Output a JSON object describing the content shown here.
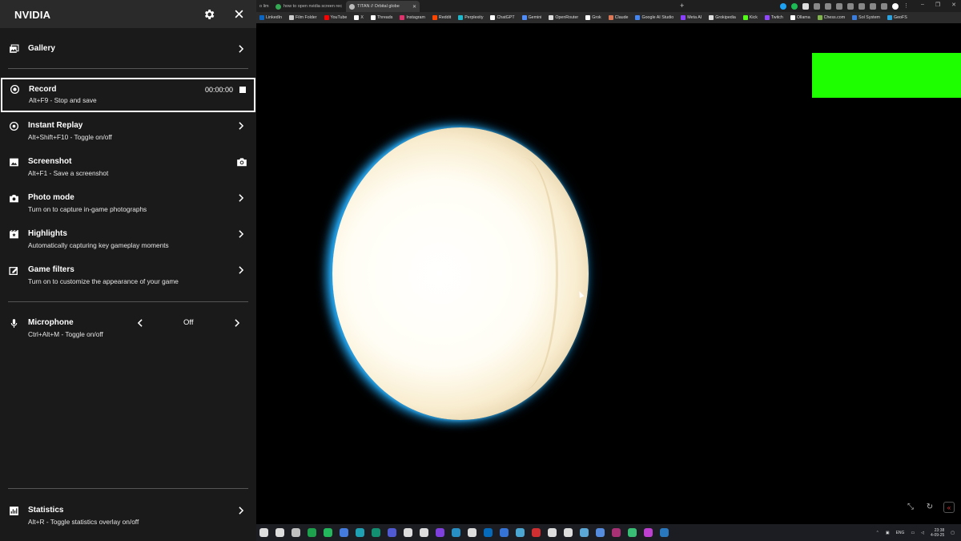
{
  "overlay": {
    "title": "NVIDIA",
    "gallery": {
      "label": "Gallery"
    },
    "record": {
      "label": "Record",
      "sub": "Alt+F9 - Stop and save",
      "time": "00:00:00"
    },
    "instant_replay": {
      "label": "Instant Replay",
      "sub": "Alt+Shift+F10 - Toggle on/off"
    },
    "screenshot": {
      "label": "Screenshot",
      "sub": "Alt+F1 - Save a screenshot"
    },
    "photo_mode": {
      "label": "Photo mode",
      "sub": "Turn on to capture in-game photographs"
    },
    "highlights": {
      "label": "Highlights",
      "sub": "Automatically capturing key gameplay moments"
    },
    "game_filters": {
      "label": "Game filters",
      "sub": "Turn on to customize the appearance of your game"
    },
    "microphone": {
      "label": "Microphone",
      "sub": "Ctrl+Alt+M - Toggle on/off",
      "value": "Off"
    },
    "statistics": {
      "label": "Statistics",
      "sub": "Alt+R - Toggle statistics overlay on/off"
    }
  },
  "browser": {
    "tabs": [
      {
        "title": "o lim",
        "state": "inactive"
      },
      {
        "title": "how to open nvidia screen rec",
        "state": "inactive"
      },
      {
        "title": "TITAN // Orbital globe",
        "state": "active"
      }
    ],
    "bookmarks": [
      {
        "label": "LinkedIn",
        "color": "#0a66c2"
      },
      {
        "label": "Film Folder",
        "color": "#cccccc"
      },
      {
        "label": "YouTube",
        "color": "#ff0000"
      },
      {
        "label": "X",
        "color": "#ffffff"
      },
      {
        "label": "Threads",
        "color": "#ffffff"
      },
      {
        "label": "Instagram",
        "color": "#e1306c"
      },
      {
        "label": "Reddit",
        "color": "#ff4500"
      },
      {
        "label": "Perplexity",
        "color": "#20b8cd"
      },
      {
        "label": "ChatGPT",
        "color": "#ffffff"
      },
      {
        "label": "Gemini",
        "color": "#4f8cf7"
      },
      {
        "label": "OpenRouter",
        "color": "#dddddd"
      },
      {
        "label": "Grok",
        "color": "#ffffff"
      },
      {
        "label": "Claude",
        "color": "#d97757"
      },
      {
        "label": "Google AI Studio",
        "color": "#4285f4"
      },
      {
        "label": "Meta AI",
        "color": "#8a3ffc"
      },
      {
        "label": "Grokipedia",
        "color": "#dddddd"
      },
      {
        "label": "Kick",
        "color": "#53fc18"
      },
      {
        "label": "Twitch",
        "color": "#9146ff"
      },
      {
        "label": "Ollama",
        "color": "#ffffff"
      },
      {
        "label": "Chess.com",
        "color": "#81b64c"
      },
      {
        "label": "Sol System",
        "color": "#3b7ddd"
      },
      {
        "label": "GeoFS",
        "color": "#2aa3e0"
      }
    ]
  },
  "taskbar": {
    "tray_lang": "ENG",
    "clock_time": "23:38",
    "clock_date": "4-09-25"
  },
  "colors": {
    "overlay_bg": "#1a1a1a",
    "overlay_header": "#2a2a2a",
    "green_rect": "#1eff00",
    "planet_rim": "#1e9fe8"
  }
}
